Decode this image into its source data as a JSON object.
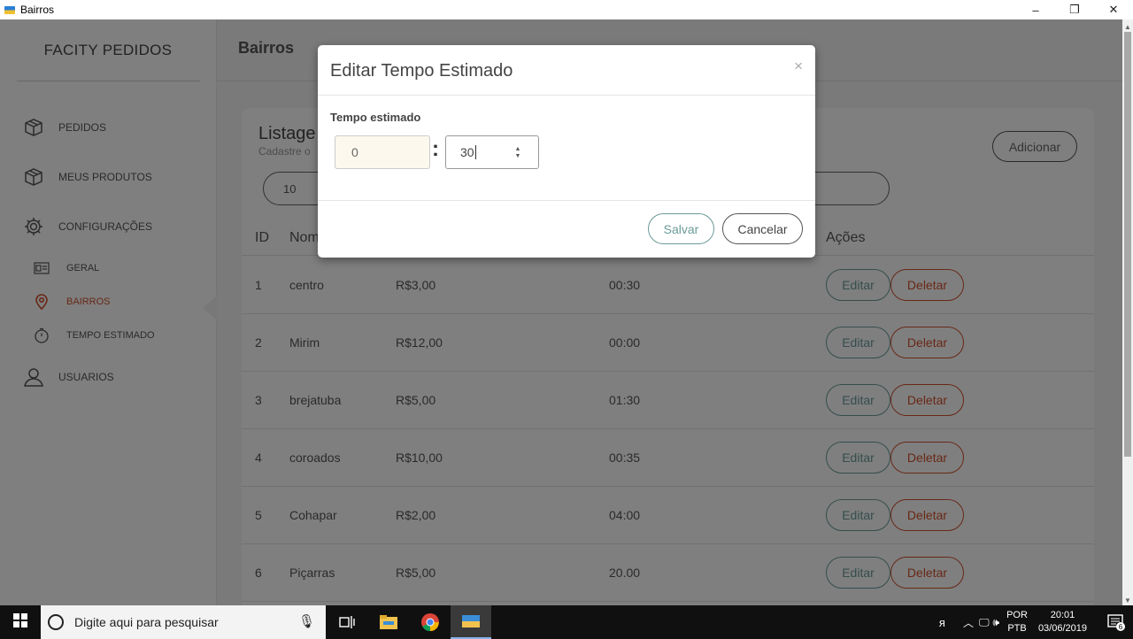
{
  "window": {
    "title": "Bairros",
    "minimize": "–",
    "restore": "❐",
    "close": "✕"
  },
  "sidebar": {
    "brand": "FACITY PEDIDOS",
    "items": [
      {
        "label": "PEDIDOS",
        "icon": "box-icon"
      },
      {
        "label": "MEUS PRODUTOS",
        "icon": "box-icon"
      },
      {
        "label": "CONFIGURAÇÕES",
        "icon": "gear-icon"
      }
    ],
    "subitems": [
      {
        "label": "GERAL",
        "icon": "id-card-icon"
      },
      {
        "label": "BAIRROS",
        "icon": "map-pin-icon"
      },
      {
        "label": "TEMPO ESTIMADO",
        "icon": "stopwatch-icon"
      }
    ],
    "users": {
      "label": "USUARIOS",
      "icon": "user-icon"
    }
  },
  "main": {
    "page_title": "Bairros",
    "card_title": "Listage",
    "card_subtitle": "Cadastre o",
    "add_button": "Adicionar",
    "page_size": "10",
    "columns": {
      "id": "ID",
      "nome": "Nom",
      "acoes": "Ações"
    },
    "rows": [
      {
        "id": "1",
        "nome": "centro",
        "preco": "R$3,00",
        "tempo": "00:30"
      },
      {
        "id": "2",
        "nome": "Mirim",
        "preco": "R$12,00",
        "tempo": "00:00"
      },
      {
        "id": "3",
        "nome": "brejatuba",
        "preco": "R$5,00",
        "tempo": "01:30"
      },
      {
        "id": "4",
        "nome": "coroados",
        "preco": "R$10,00",
        "tempo": "00:35"
      },
      {
        "id": "5",
        "nome": "Cohapar",
        "preco": "R$2,00",
        "tempo": "04:00"
      },
      {
        "id": "6",
        "nome": "Piçarras",
        "preco": "R$5,00",
        "tempo": "20.00"
      }
    ],
    "edit_label": "Editar",
    "delete_label": "Deletar"
  },
  "modal": {
    "title": "Editar Tempo Estimado",
    "close": "×",
    "field_label": "Tempo estimado",
    "hours_value": "0",
    "separator": ":",
    "minutes_value": "30",
    "save_label": "Salvar",
    "cancel_label": "Cancelar"
  },
  "taskbar": {
    "search_placeholder": "Digite aqui para pesquisar",
    "lang_top": "POR",
    "lang_bottom": "PTB",
    "time": "20:01",
    "date": "03/06/2019",
    "notifications": "6"
  },
  "colors": {
    "accent_teal": "#6a9a98",
    "accent_red": "#d0512d"
  }
}
